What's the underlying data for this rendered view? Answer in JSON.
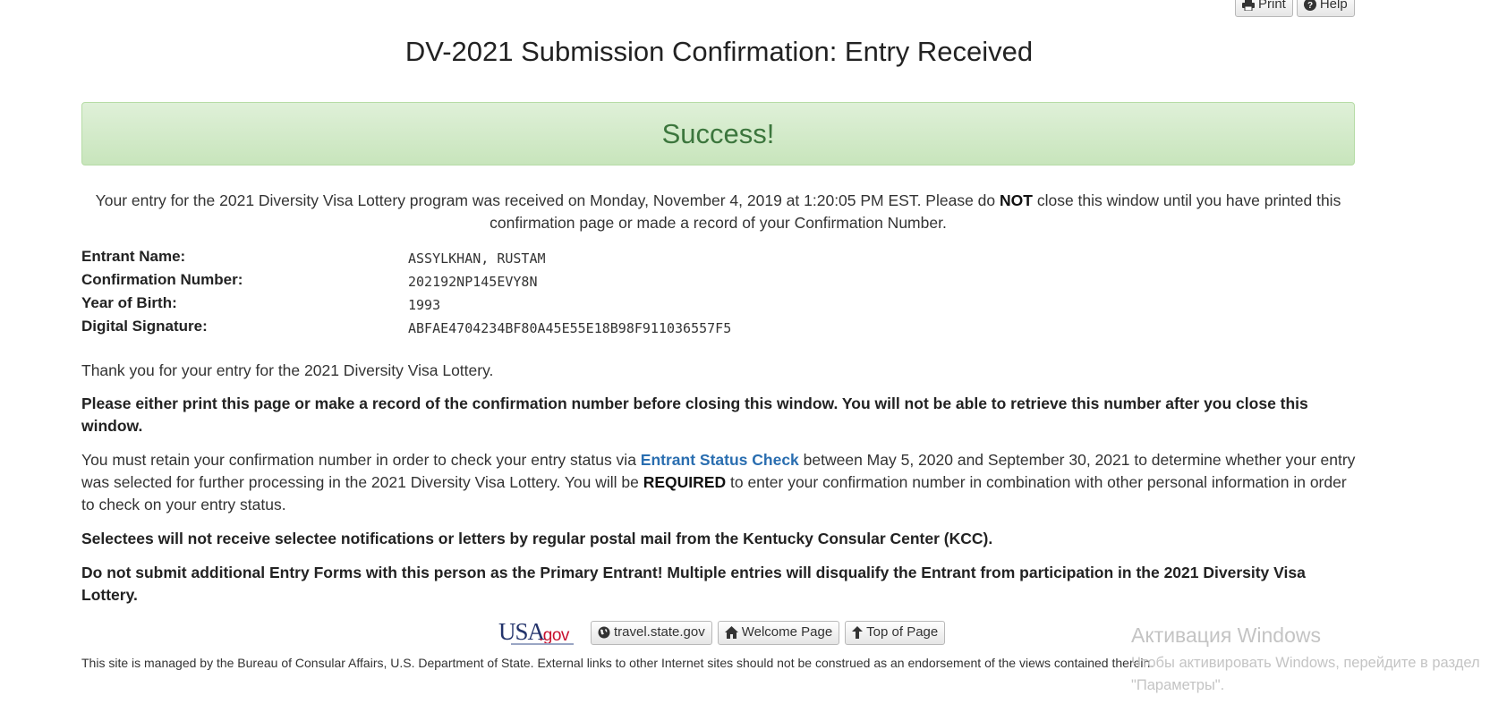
{
  "toolbar": {
    "print_label": "Print",
    "help_label": "Help"
  },
  "header": {
    "title": "DV-2021 Submission Confirmation: Entry Received"
  },
  "alert": {
    "text": "Success!",
    "color": "#3c763d"
  },
  "received": {
    "before": "Your entry for the 2021 Diversity Visa Lottery program was received on Monday, November 4, 2019 at 1:20:05 PM EST. Please do ",
    "emphasis": "NOT",
    "after": " close this window until you have printed this confirmation page or made a record of your Confirmation Number."
  },
  "details": [
    {
      "label": "Entrant Name:",
      "value": "ASSYLKHAN, RUSTAM"
    },
    {
      "label": "Confirmation Number:",
      "value": "202192NP145EVY8N"
    },
    {
      "label": "Year of Birth:",
      "value": "1993"
    },
    {
      "label": "Digital Signature:",
      "value": "ABFAE4704234BF80A45E55E18B98F911036557F5"
    }
  ],
  "content": {
    "thank_you": "Thank you for your entry for the 2021 Diversity Visa Lottery.",
    "print_warning": "Please either print this page or make a record of the confirmation number before closing this window. You will not be able to retrieve this number after you close this window.",
    "retain_before": "You must retain your confirmation number in order to check your entry status via ",
    "retain_link": "Entrant Status Check",
    "retain_middle": " between May 5, 2020 and September 30, 2021 to determine whether your entry was selected for further processing in the 2021 Diversity Visa Lottery. You will be ",
    "retain_required": "REQUIRED",
    "retain_after": " to enter your confirmation number in combination with other personal information in order to check on your entry status.",
    "selectees_notice": "Selectees will not receive selectee notifications or letters by regular postal mail from the Kentucky Consular Center (KCC).",
    "no_additional": "Do not submit additional Entry Forms with this person as the Primary Entrant! Multiple entries will disqualify the Entrant from participation in the 2021 Diversity Visa Lottery."
  },
  "footer": {
    "logo_usa": "USA",
    "logo_gov": ".gov",
    "travel_label": "travel.state.gov",
    "welcome_label": "Welcome Page",
    "top_label": "Top of Page",
    "disclaimer": "This site is managed by the Bureau of Consular Affairs, U.S. Department of State. External links to other Internet sites should not be construed as an endorsement of the views contained therein."
  },
  "watermark": {
    "title": "Активация Windows",
    "text": "Чтобы активировать Windows, перейдите в раздел\n\"Параметры\"."
  },
  "colors": {
    "link": "#2a6eb0",
    "alert_bg": "#dff0d8",
    "alert_border": "#b6dca6"
  }
}
